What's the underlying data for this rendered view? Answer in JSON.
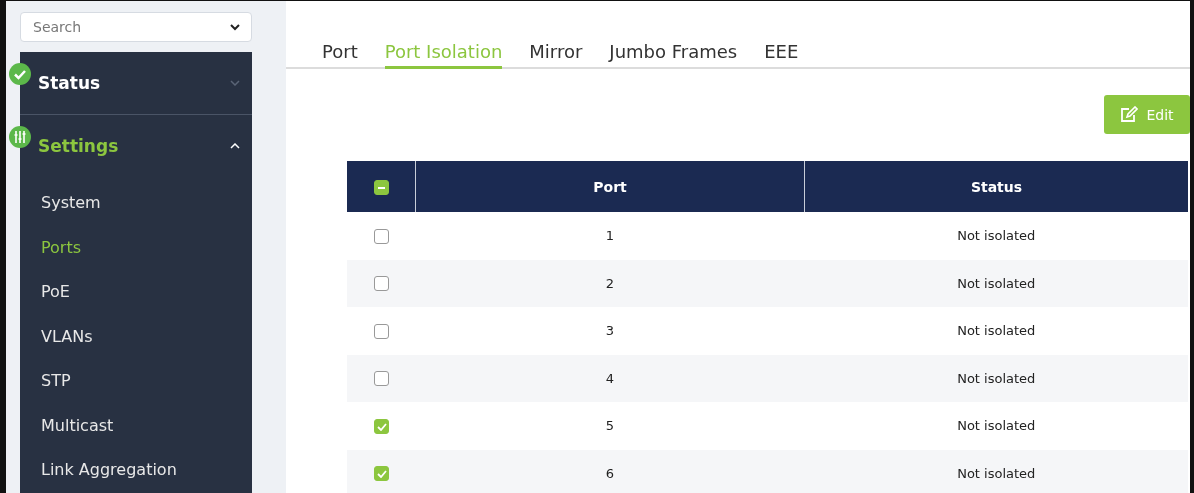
{
  "search": {
    "placeholder": "Search"
  },
  "sidebar": {
    "sections": [
      {
        "kind": "status",
        "label": "Status",
        "selected": false,
        "expanded": false
      },
      {
        "kind": "settings",
        "label": "Settings",
        "selected": true,
        "expanded": true,
        "items": [
          {
            "label": "System",
            "selected": false
          },
          {
            "label": "Ports",
            "selected": true
          },
          {
            "label": "PoE",
            "selected": false
          },
          {
            "label": "VLANs",
            "selected": false
          },
          {
            "label": "STP",
            "selected": false
          },
          {
            "label": "Multicast",
            "selected": false
          },
          {
            "label": "Link Aggregation",
            "selected": false
          }
        ]
      }
    ]
  },
  "tabs": [
    {
      "label": "Port",
      "selected": false
    },
    {
      "label": "Port Isolation",
      "selected": true
    },
    {
      "label": "Mirror",
      "selected": false
    },
    {
      "label": "Jumbo Frames",
      "selected": false
    },
    {
      "label": "EEE",
      "selected": false
    }
  ],
  "edit_button": {
    "label": "Edit"
  },
  "table": {
    "select_all": {
      "indeterminate": true
    },
    "columns": [
      "Port",
      "Status"
    ],
    "rows": [
      {
        "checked": false,
        "port": "1",
        "status": "Not isolated"
      },
      {
        "checked": false,
        "port": "2",
        "status": "Not isolated"
      },
      {
        "checked": false,
        "port": "3",
        "status": "Not isolated"
      },
      {
        "checked": false,
        "port": "4",
        "status": "Not isolated"
      },
      {
        "checked": true,
        "port": "5",
        "status": "Not isolated"
      },
      {
        "checked": true,
        "port": "6",
        "status": "Not isolated"
      }
    ]
  }
}
